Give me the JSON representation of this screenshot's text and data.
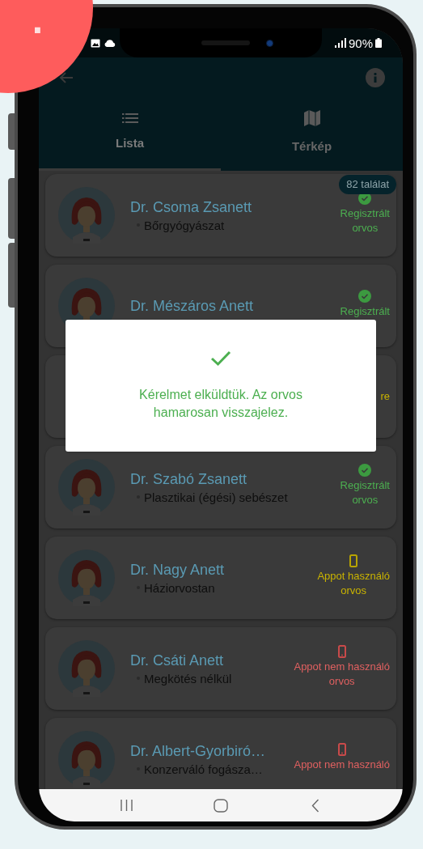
{
  "step_badge": {
    "text": "."
  },
  "status_bar": {
    "battery": "90%"
  },
  "tabs": [
    {
      "label": "Lista",
      "selected": true
    },
    {
      "label": "Térkép",
      "selected": false
    }
  ],
  "result_count": "82 találat",
  "doctors": [
    {
      "name": "Dr. Csoma Zsanett",
      "specialty": "Bőrgyógyászat",
      "kind": "registered",
      "status": "Regisztrált\norvos"
    },
    {
      "name": "Dr. Mészáros Anett",
      "kind": "registered",
      "status": "Regisztrált"
    },
    {
      "kind": "app_user",
      "status": "re"
    },
    {
      "name": "Dr. Szabó Zsanett",
      "specialty": "Plasztikai (égési) sebészet",
      "kind": "registered",
      "status": "Regisztrált\norvos"
    },
    {
      "name": "Dr. Nagy Anett",
      "specialty": "Háziorvostan",
      "kind": "app_user",
      "status": "Appot használó\norvos"
    },
    {
      "name": "Dr. Csáti Anett",
      "specialty": "Megkötés nélkül",
      "kind": "app_non_user",
      "status": "Appot nem használó\norvos"
    },
    {
      "name": "Dr.  Albert-Gyorbiró…",
      "specialty": "Konzerváló fogásza…",
      "kind": "app_non_user",
      "status": "Appot nem használó"
    }
  ],
  "dialog": {
    "message": "Kérelmet elküldtük. Az orvos hamarosan visszajelez."
  }
}
